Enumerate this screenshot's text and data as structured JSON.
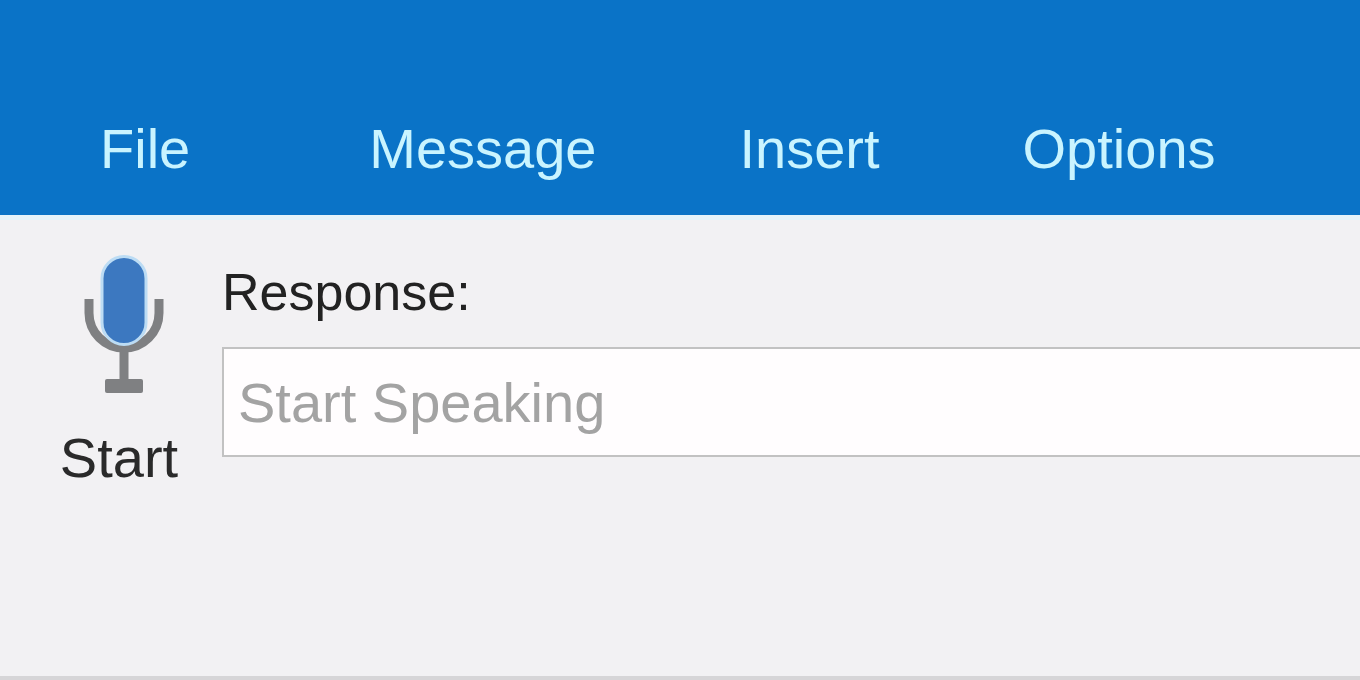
{
  "ribbon_tabs": [
    {
      "label": "File"
    },
    {
      "label": "Message"
    },
    {
      "label": "Insert"
    },
    {
      "label": "Options"
    }
  ],
  "dictation": {
    "start_button": {
      "label": "Start"
    },
    "response": {
      "label": "Response:",
      "placeholder": "Start Speaking"
    }
  }
}
